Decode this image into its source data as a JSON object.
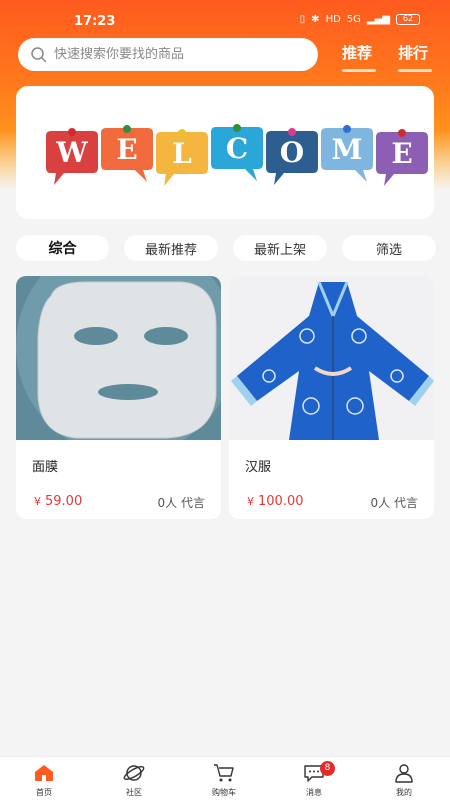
{
  "status_bar": {
    "time": "17:23",
    "battery": "62",
    "network": "5G"
  },
  "search": {
    "placeholder": "快速搜索你要找的商品"
  },
  "header_tabs": [
    {
      "label": "推荐"
    },
    {
      "label": "排行"
    }
  ],
  "banner": {
    "letters": [
      "W",
      "E",
      "L",
      "C",
      "O",
      "M",
      "E"
    ]
  },
  "filters": [
    {
      "label": "综合"
    },
    {
      "label": "最新推荐"
    },
    {
      "label": "最新上架"
    },
    {
      "label": "筛选"
    }
  ],
  "products": [
    {
      "name": "面膜",
      "currency": "¥",
      "price": "59.00",
      "reviews": "0人 代言"
    },
    {
      "name": "汉服",
      "currency": "¥",
      "price": "100.00",
      "reviews": "0人 代言"
    }
  ],
  "tabbar": [
    {
      "label": "首页",
      "icon": "home-icon"
    },
    {
      "label": "社区",
      "icon": "planet-icon"
    },
    {
      "label": "购物车",
      "icon": "cart-icon"
    },
    {
      "label": "消息",
      "icon": "message-icon",
      "badge": "8"
    },
    {
      "label": "我的",
      "icon": "user-icon"
    }
  ],
  "colors": {
    "accent": "#ff5a1f",
    "price": "#e53935",
    "badge": "#e62a2a"
  }
}
